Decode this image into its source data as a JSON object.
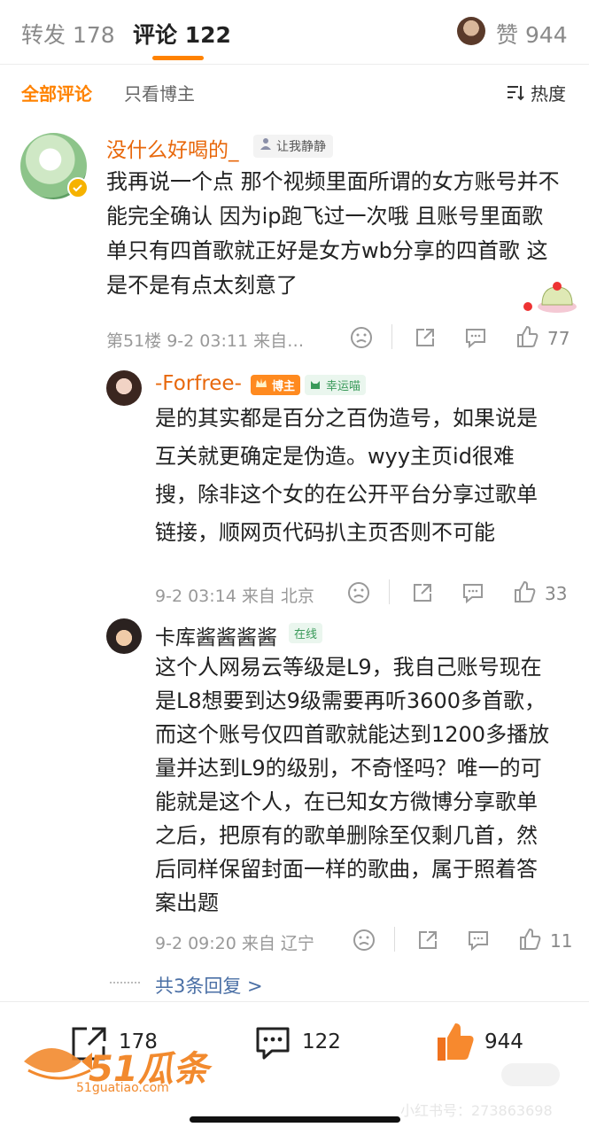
{
  "tabs": {
    "repost": "转发 178",
    "comments": "评论 122",
    "likes": "赞 944"
  },
  "filters": {
    "all": "全部评论",
    "author_only": "只看博主",
    "sort": "热度"
  },
  "comments": [
    {
      "user": "没什么好喝的_",
      "badge": "让我静静",
      "text": "我再说一个点 那个视频里面所谓的女方账号并不能完全确认 因为ip跑飞过一次哦 且账号里面歌单只有四首歌就正好是女方wb分享的四首歌 这是不是有点太刻意了",
      "meta": "第51楼 9-2 03:11 来自…",
      "likes": "77"
    }
  ],
  "replies": [
    {
      "user": "-Forfree-",
      "badge_host": "博主",
      "badge_lucky": "幸运喵",
      "text": "是的其实都是百分之百伪造号，如果说是互关就更确定是伪造。wyy主页id很难搜，除非这个女的在公开平台分享过歌单链接，顺网页代码扒主页否则不可能",
      "meta": "9-2 03:14 来自 北京",
      "likes": "33"
    },
    {
      "user": "卡库酱酱酱酱",
      "badge": "在线",
      "text": "这个人网易云等级是L9，我自己账号现在是L8想要到达9级需要再听3600多首歌，而这个账号仅四首歌就能达到1200多播放量并达到L9的级别，不奇怪吗？唯一的可能就是这个人，在已知女方微博分享歌单之后，把原有的歌单删除至仅剩几首，然后同样保留封面一样的歌曲，属于照着答案出题",
      "meta": "9-2 09:20 来自 辽宁",
      "likes": "11"
    }
  ],
  "more_replies": "共3条回复 >",
  "bottom_bar": {
    "share_count": "178",
    "comment_count": "122",
    "like_count": "944"
  },
  "watermark": {
    "brand": "51瓜条",
    "url": "51guatiao.com",
    "xhs": "小红书号：273863698"
  },
  "colors": {
    "accent": "#ff8200",
    "name_orange": "#e8680c",
    "meta_gray": "#999999"
  }
}
